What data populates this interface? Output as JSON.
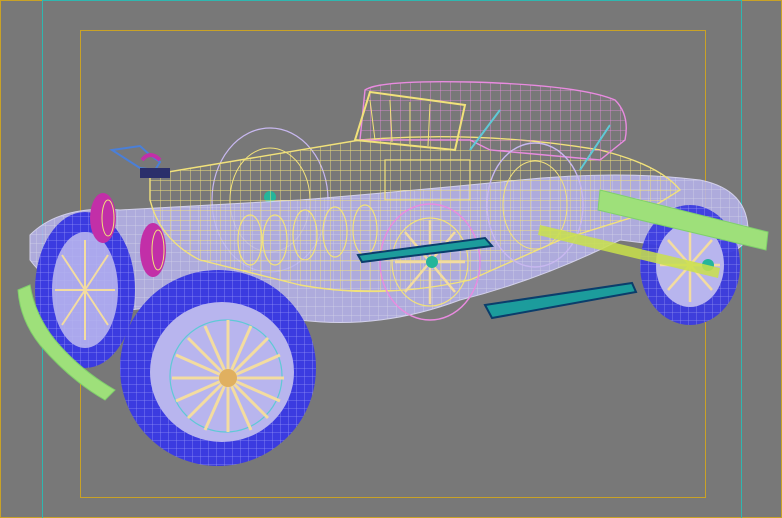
{
  "viewport": {
    "background": "#787878",
    "safe_frame_outer_color": "#2fb7b0",
    "safe_frame_inner_color": "#c9a227"
  },
  "model": {
    "colors": {
      "body": "#f2e27a",
      "roof": "#e98be0",
      "tires": "#3b3be0",
      "fenders": "#b7b4f2",
      "spokes": "#f3dca0",
      "headlamps": "#c22fa8",
      "bumper": "#9ee07a",
      "running_board": "#1c9c9c",
      "hub": "#25b59a"
    }
  }
}
